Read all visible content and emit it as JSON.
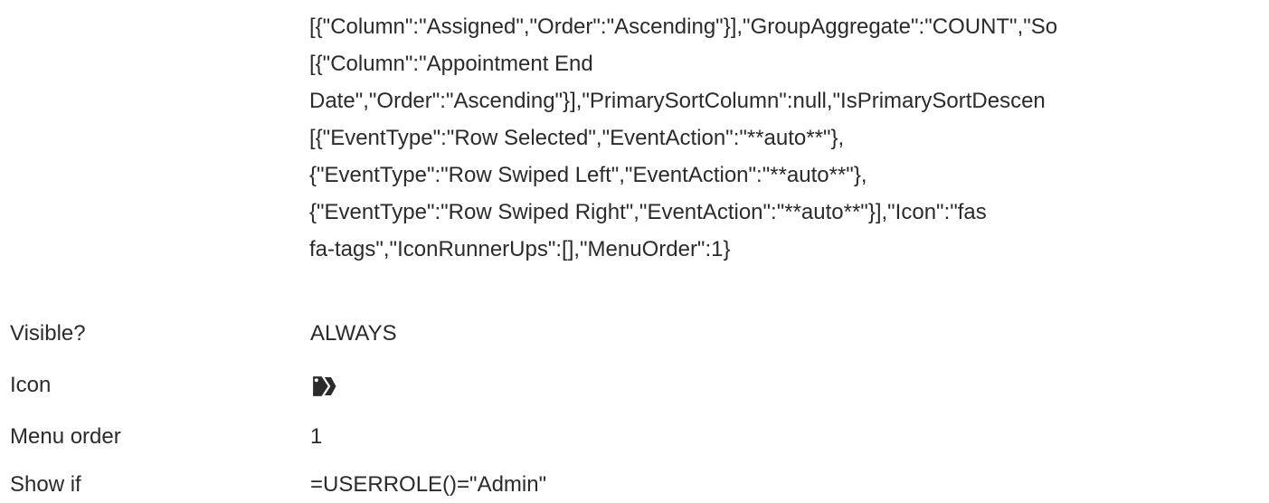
{
  "json_value": {
    "lines": [
      "[{\"Column\":\"Assigned\",\"Order\":\"Ascending\"}],\"GroupAggregate\":\"COUNT\",\"So",
      "[{\"Column\":\"Appointment End",
      "Date\",\"Order\":\"Ascending\"}],\"PrimarySortColumn\":null,\"IsPrimarySortDescen",
      "[{\"EventType\":\"Row Selected\",\"EventAction\":\"**auto**\"},",
      "{\"EventType\":\"Row Swiped Left\",\"EventAction\":\"**auto**\"},",
      "{\"EventType\":\"Row Swiped Right\",\"EventAction\":\"**auto**\"}],\"Icon\":\"fas",
      "fa-tags\",\"IconRunnerUps\":[],\"MenuOrder\":1}"
    ]
  },
  "properties": {
    "visible": {
      "label": "Visible?",
      "value": "ALWAYS"
    },
    "icon": {
      "label": "Icon",
      "icon_name": "tags-icon"
    },
    "menu_order": {
      "label": "Menu order",
      "value": "1"
    },
    "show_if": {
      "label": "Show if",
      "value": "=USERROLE()=\"Admin\""
    }
  },
  "colors": {
    "text": "#2b2b2b",
    "icon": "#2b2b2b",
    "background": "#ffffff"
  }
}
